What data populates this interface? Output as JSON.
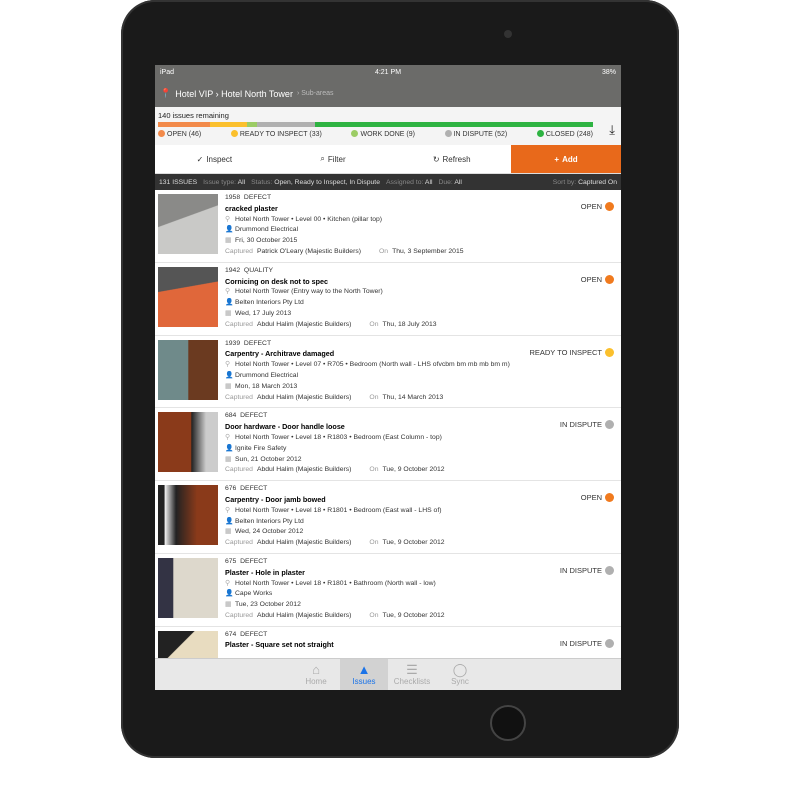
{
  "status_bar": {
    "device": "iPad",
    "time": "4:21 PM",
    "battery": "38%"
  },
  "header": {
    "title": "Hotel VIP › Hotel North Tower",
    "sub": "› Sub-areas"
  },
  "progress": {
    "remaining": "140 issues remaining",
    "segments": [
      {
        "label": "OPEN (46)",
        "count": 46,
        "color": "#f28a4a"
      },
      {
        "label": "READY TO INSPECT (33)",
        "count": 33,
        "color": "#fbc02d"
      },
      {
        "label": "WORK DONE (9)",
        "count": 9,
        "color": "#9ccc65"
      },
      {
        "label": "IN DISPUTE (52)",
        "count": 52,
        "color": "#b0b0b0"
      },
      {
        "label": "CLOSED (248)",
        "count": 248,
        "color": "#2eb342"
      }
    ]
  },
  "toolbar": {
    "inspect": "Inspect",
    "filter": "Filter",
    "refresh": "Refresh",
    "add": "Add"
  },
  "filters": {
    "count": "131 ISSUES",
    "issue_type_k": "Issue type:",
    "issue_type": "All",
    "status_k": "Status:",
    "status": "Open, Ready to Inspect, In Dispute",
    "assigned_k": "Assigned to:",
    "assigned": "All",
    "due_k": "Due:",
    "due": "All",
    "sort_k": "Sort by:",
    "sort": "Captured On"
  },
  "labels": {
    "captured": "Captured",
    "on": "On"
  },
  "status_colors": {
    "OPEN": "#f07a1e",
    "READY TO INSPECT": "#fbc02d",
    "IN DISPUTE": "#b0b0b0"
  },
  "issues": [
    {
      "id": "1958",
      "type": "DEFECT",
      "title": "cracked plaster",
      "location": "Hotel North Tower • Level 00 • Kitchen (pillar top)",
      "assignee": "Drummond Electrical",
      "due": "Fri, 30 October 2015",
      "captured_by": "Patrick O'Leary (Majestic Builders)",
      "captured_on": "Thu, 3 September 2015",
      "status": "OPEN"
    },
    {
      "id": "1942",
      "type": "QUALITY",
      "title": "Cornicing on desk not to spec",
      "location": "Hotel North Tower (Entry way to the North Tower)",
      "assignee": "Belten Interiors Pty Ltd",
      "due": "Wed, 17 July 2013",
      "captured_by": "Abdul Halim (Majestic Builders)",
      "captured_on": "Thu, 18 July 2013",
      "status": "OPEN"
    },
    {
      "id": "1939",
      "type": "DEFECT",
      "title": "Carpentry - Architrave damaged",
      "location": "Hotel North Tower • Level 07 • R705 • Bedroom (North wall - LHS ofvcbm bm mb mb bm m)",
      "assignee": "Drummond Electrical",
      "due": "Mon, 18 March 2013",
      "captured_by": "Abdul Halim (Majestic Builders)",
      "captured_on": "Thu, 14 March 2013",
      "status": "READY TO INSPECT"
    },
    {
      "id": "684",
      "type": "DEFECT",
      "title": "Door hardware - Door handle loose",
      "location": "Hotel North Tower • Level 18 • R1803 • Bedroom (East Column - top)",
      "assignee": "Ignite Fire Safety",
      "due": "Sun, 21 October 2012",
      "captured_by": "Abdul Halim (Majestic Builders)",
      "captured_on": "Tue, 9 October 2012",
      "status": "IN DISPUTE"
    },
    {
      "id": "676",
      "type": "DEFECT",
      "title": "Carpentry - Door jamb bowed",
      "location": "Hotel North Tower • Level 18 • R1801 • Bedroom (East wall - LHS of)",
      "assignee": "Belten Interiors Pty Ltd",
      "due": "Wed, 24 October 2012",
      "captured_by": "Abdul Halim (Majestic Builders)",
      "captured_on": "Tue, 9 October 2012",
      "status": "OPEN"
    },
    {
      "id": "675",
      "type": "DEFECT",
      "title": "Plaster - Hole in plaster",
      "location": "Hotel North Tower • Level 18 • R1801 • Bathroom (North wall - low)",
      "assignee": "Cape Works",
      "due": "Tue, 23 October 2012",
      "captured_by": "Abdul Halim (Majestic Builders)",
      "captured_on": "Tue, 9 October 2012",
      "status": "IN DISPUTE"
    },
    {
      "id": "674",
      "type": "DEFECT",
      "title": "Plaster - Square set not straight",
      "location": "",
      "assignee": "",
      "due": "",
      "captured_by": "",
      "captured_on": "",
      "status": "IN DISPUTE"
    }
  ],
  "tabs": [
    {
      "label": "Home",
      "icon": "home-icon"
    },
    {
      "label": "Issues",
      "icon": "warning-icon",
      "active": true
    },
    {
      "label": "Checklists",
      "icon": "checklist-icon"
    },
    {
      "label": "Sync",
      "icon": "sync-icon"
    }
  ]
}
